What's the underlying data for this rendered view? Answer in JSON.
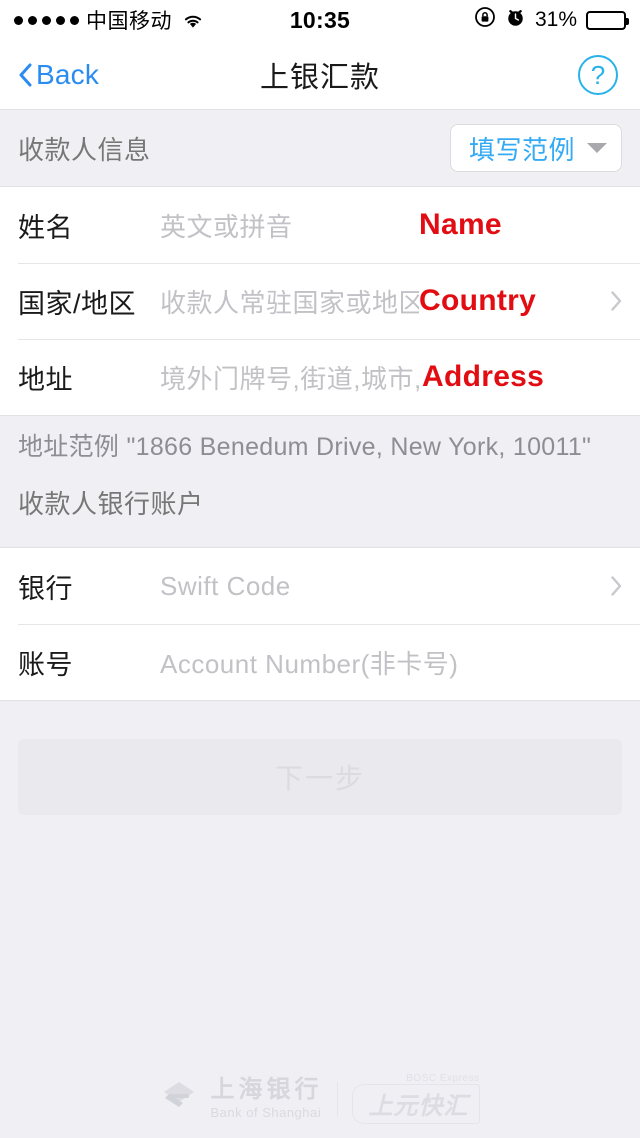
{
  "statusbar": {
    "signal_dots": 5,
    "carrier": "中国移动",
    "wifi_icon": "wifi-icon",
    "time": "10:35",
    "rotation_lock_icon": "rotation-lock-icon",
    "alarm_icon": "alarm-clock-icon",
    "battery_percent": "31%",
    "battery_level": 31
  },
  "navbar": {
    "back_label": "Back",
    "back_icon": "chevron-left-icon",
    "title": "上银汇款",
    "help_icon": "question-mark-circle-icon",
    "help_glyph": "?"
  },
  "payee_section": {
    "title": "收款人信息",
    "sample_button_label": "填写范例",
    "sample_button_icon": "chevron-down-icon",
    "rows": [
      {
        "label": "姓名",
        "placeholder": "英文或拼音",
        "value": "",
        "annotation": "Name",
        "has_chevron": false
      },
      {
        "label": "国家/地区",
        "placeholder": "收款人常驻国家或地区",
        "value": "",
        "annotation": "Country",
        "has_chevron": true
      },
      {
        "label": "地址",
        "placeholder": "境外门牌号,街道,城市,邮编",
        "value": "",
        "annotation": "Address",
        "has_chevron": false
      }
    ]
  },
  "hint_band": {
    "address_example": "地址范例 \"1866 Benedum Drive, New York, 10011\"",
    "bank_section_title": "收款人银行账户"
  },
  "bank_section": {
    "rows": [
      {
        "label": "银行",
        "placeholder": "Swift Code",
        "value": "",
        "has_chevron": true
      },
      {
        "label": "账号",
        "placeholder": "Account Number(非卡号)",
        "value": "",
        "has_chevron": false
      }
    ]
  },
  "next_button": {
    "label": "下一步",
    "enabled": false
  },
  "footer": {
    "bank_name_cn": "上海银行",
    "bank_name_en": "Bank of Shanghai",
    "product_sup": "BOSC Express",
    "product_name": "上元快汇"
  },
  "colors": {
    "ios_blue": "#2a8cf0",
    "help_cyan": "#27b3ea",
    "sample_blue": "#34aaf5",
    "annotation_red": "#e20d13",
    "page_bg": "#f0f0f4",
    "card_bg": "#ffffff",
    "placeholder_gray": "#c2c2c6"
  }
}
